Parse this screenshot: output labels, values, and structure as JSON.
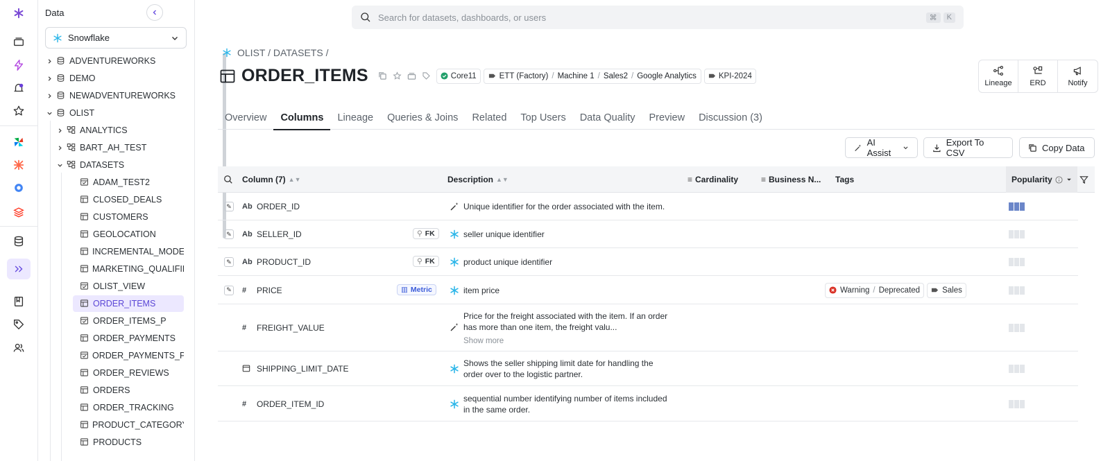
{
  "sidebar": {
    "title": "Data",
    "source": "Snowflake",
    "tree": [
      {
        "label": "ADVENTUREWORKS",
        "level": 0,
        "state": "collapsed",
        "kind": "database"
      },
      {
        "label": "DEMO",
        "level": 0,
        "state": "collapsed",
        "kind": "database"
      },
      {
        "label": "NEWADVENTUREWORKS",
        "level": 0,
        "state": "collapsed",
        "kind": "database"
      },
      {
        "label": "OLIST",
        "level": 0,
        "state": "expanded",
        "kind": "database"
      },
      {
        "label": "ANALYTICS",
        "level": 1,
        "state": "collapsed",
        "kind": "schema"
      },
      {
        "label": "BART_AH_TEST",
        "level": 1,
        "state": "collapsed",
        "kind": "schema"
      },
      {
        "label": "DATASETS",
        "level": 1,
        "state": "expanded",
        "kind": "schema"
      },
      {
        "label": "ADAM_TEST2",
        "level": 2,
        "kind": "view"
      },
      {
        "label": "CLOSED_DEALS",
        "level": 2,
        "kind": "table"
      },
      {
        "label": "CUSTOMERS",
        "level": 2,
        "kind": "table"
      },
      {
        "label": "GEOLOCATION",
        "level": 2,
        "kind": "table"
      },
      {
        "label": "INCREMENTAL_MODEL",
        "level": 2,
        "kind": "table"
      },
      {
        "label": "MARKETING_QUALIFIEI",
        "level": 2,
        "kind": "table"
      },
      {
        "label": "OLIST_VIEW",
        "level": 2,
        "kind": "view"
      },
      {
        "label": "ORDER_ITEMS",
        "level": 2,
        "kind": "table",
        "active": true
      },
      {
        "label": "ORDER_ITEMS_P",
        "level": 2,
        "kind": "view"
      },
      {
        "label": "ORDER_PAYMENTS",
        "level": 2,
        "kind": "table"
      },
      {
        "label": "ORDER_PAYMENTS_P",
        "level": 2,
        "kind": "view"
      },
      {
        "label": "ORDER_REVIEWS",
        "level": 2,
        "kind": "table"
      },
      {
        "label": "ORDERS",
        "level": 2,
        "kind": "table"
      },
      {
        "label": "ORDER_TRACKING",
        "level": 2,
        "kind": "table"
      },
      {
        "label": "PRODUCT_CATEGORY_",
        "level": 2,
        "kind": "table"
      },
      {
        "label": "PRODUCTS",
        "level": 2,
        "kind": "table"
      }
    ]
  },
  "search": {
    "placeholder": "Search for datasets, dashboards, or users",
    "kbd1": "⌘",
    "kbd2": "K"
  },
  "header": {
    "breadcrumb": "OLIST / DATASETS /",
    "title": "ORDER_ITEMS",
    "chip_core": "Core11",
    "chip_path": [
      "ETT (Factory)",
      "Machine 1",
      "Sales2",
      "Google Analytics"
    ],
    "chip_kpi": "KPI-2024",
    "actions": [
      {
        "label": "Lineage",
        "icon": "lineage-icon"
      },
      {
        "label": "ERD",
        "icon": "erd-icon"
      },
      {
        "label": "Notify",
        "icon": "megaphone-icon"
      }
    ]
  },
  "tabs": [
    "Overview",
    "Columns",
    "Lineage",
    "Queries & Joins",
    "Related",
    "Top Users",
    "Data Quality",
    "Preview",
    "Discussion (3)"
  ],
  "active_tab": "Columns",
  "toolbar": {
    "ai_assist": "AI Assist",
    "export": "Export To CSV",
    "copy": "Copy Data"
  },
  "table": {
    "headers": {
      "column": "Column (7)",
      "description": "Description",
      "cardinality": "Cardinality",
      "business": "Business N...",
      "tags": "Tags",
      "popularity": "Popularity"
    },
    "rows": [
      {
        "type": "Ab",
        "name": "ORDER_ID",
        "badge": "",
        "desc": "Unique identifier for the order associated with the item.",
        "desc_src": "ai",
        "popularity": 3,
        "editable": true
      },
      {
        "type": "Ab",
        "name": "SELLER_ID",
        "badge": "FK",
        "desc": "seller unique identifier",
        "desc_src": "snowflake",
        "popularity": 0,
        "editable": true
      },
      {
        "type": "Ab",
        "name": "PRODUCT_ID",
        "badge": "FK",
        "desc": "product unique identifier",
        "desc_src": "snowflake",
        "popularity": 0,
        "editable": true
      },
      {
        "type": "#",
        "name": "PRICE",
        "badge": "Metric",
        "desc": "item price",
        "desc_src": "snowflake",
        "popularity": 0,
        "editable": true,
        "tags": {
          "status": "Warning",
          "sub": "Deprecated",
          "tag": "Sales"
        }
      },
      {
        "type": "#",
        "name": "FREIGHT_VALUE",
        "badge": "",
        "desc": "Price for the freight associated with the item. If an order has more than one item, the freight valu...",
        "show_more": "Show more",
        "desc_src": "ai",
        "popularity": 0
      },
      {
        "type": "cal",
        "name": "SHIPPING_LIMIT_DATE",
        "badge": "",
        "desc": "Shows the seller shipping limit date for handling the order over to the logistic partner.",
        "desc_src": "snowflake",
        "popularity": 0
      },
      {
        "type": "#",
        "name": "ORDER_ITEM_ID",
        "badge": "",
        "desc": "sequential number identifying number of items included in the same order.",
        "desc_src": "snowflake",
        "popularity": 0
      }
    ]
  },
  "colors": {
    "accent": "#5b47d6",
    "snowflake": "#29b5e8",
    "core": "#22a06b",
    "warning": "#d93025"
  }
}
